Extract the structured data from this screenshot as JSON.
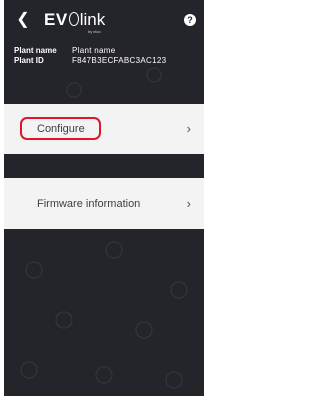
{
  "header": {
    "back_icon": "chevron-left-icon",
    "logo_ev": "EV",
    "logo_link": "link",
    "logo_sub": "by elco",
    "help_icon": "question-icon",
    "help_symbol": "?"
  },
  "plant_info": {
    "name_label": "Plant name",
    "name_value": "Plant name",
    "id_label": "Plant ID",
    "id_value": "F847B3ECFABC3AC123"
  },
  "menu": {
    "configure_label": "Configure",
    "firmware_label": "Firmware information",
    "chevron_icon": "chevron-right-icon"
  },
  "colors": {
    "background": "#24242b",
    "card": "#f3f3f3",
    "highlight": "#e0142a"
  }
}
